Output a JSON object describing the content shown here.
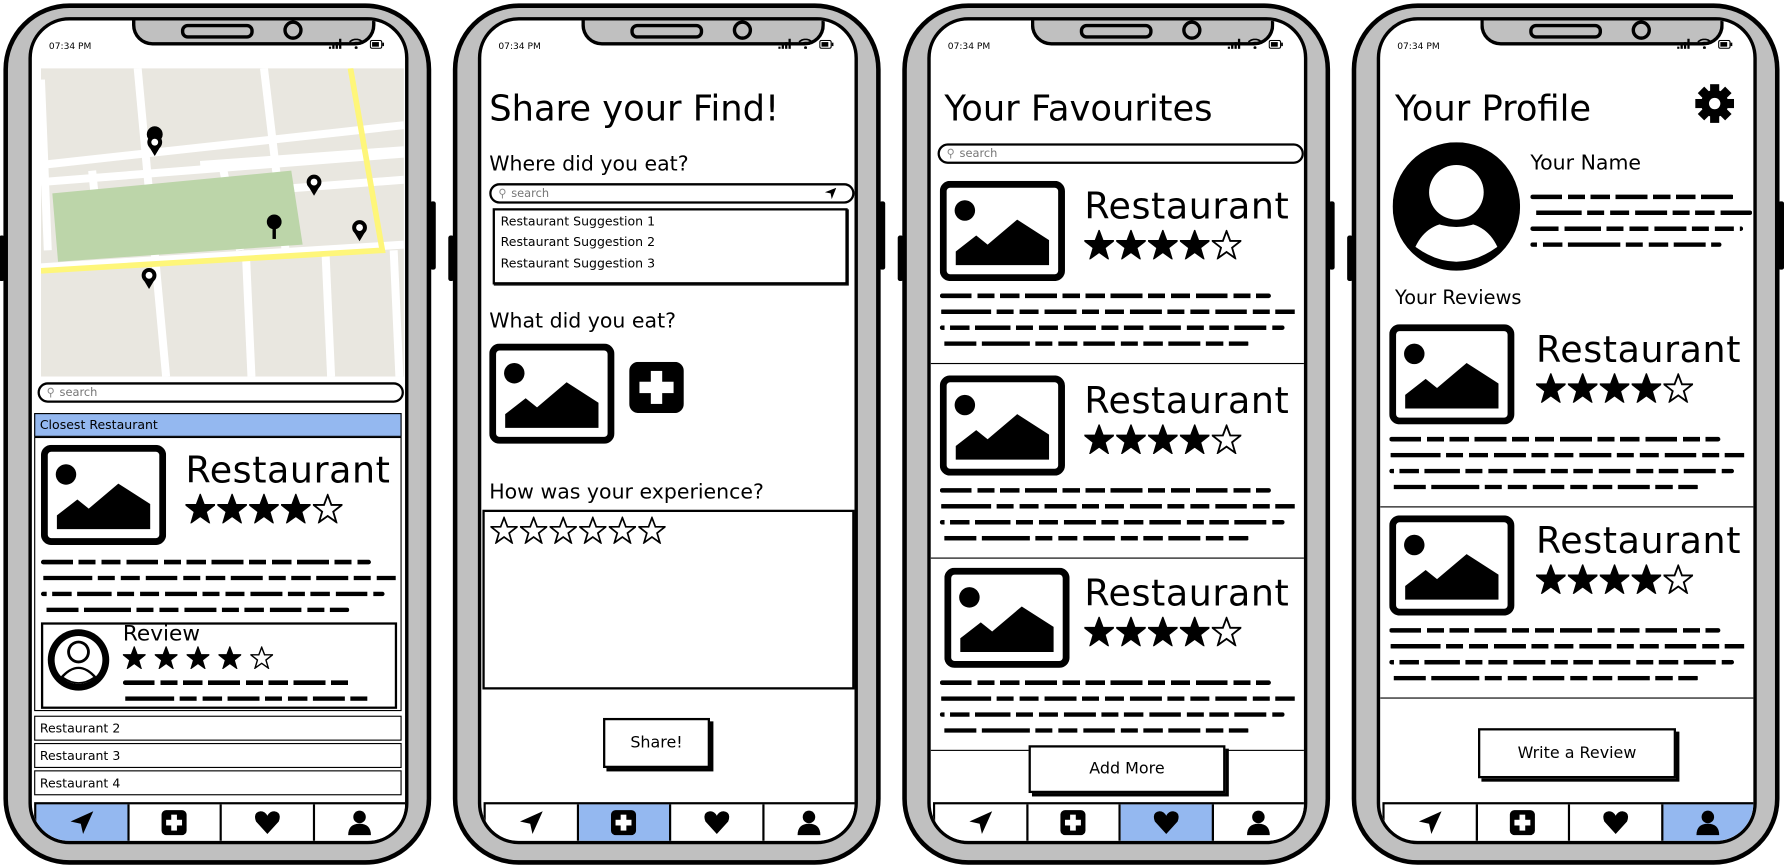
{
  "status_bar": {
    "time": "07:34 PM"
  },
  "colors": {
    "active_tab": "#94b8f0",
    "header_bar": "#94b8f0",
    "phone_frame": "#c0c0c0",
    "map_bg": "#e9e7e0",
    "park": "#bcd5a9",
    "main_road": "#fef67a"
  },
  "tabs": [
    {
      "name": "navigate",
      "icon": "navigation-arrow-icon"
    },
    {
      "name": "add",
      "icon": "plus-square-icon"
    },
    {
      "name": "favourites",
      "icon": "heart-icon"
    },
    {
      "name": "profile",
      "icon": "person-icon"
    }
  ],
  "map_screen": {
    "active_tab": 0,
    "search_placeholder": "search",
    "closest_header": "Closest Restaurant",
    "featured": {
      "name": "Restaurant",
      "rating": 4,
      "max_rating": 5
    },
    "review": {
      "label": "Review",
      "rating": 4,
      "max_rating": 5
    },
    "list": [
      "Restaurant 2",
      "Restaurant 3",
      "Restaurant 4"
    ]
  },
  "share_screen": {
    "active_tab": 1,
    "title": "Share your Find!",
    "where_label": "Where did you eat?",
    "search_placeholder": "search",
    "suggestions": [
      "Restaurant Suggestion 1",
      "Restaurant Suggestion 2",
      "Restaurant Suggestion 3"
    ],
    "what_label": "What did you eat?",
    "experience_label": "How was your experience?",
    "rating": 0,
    "max_rating": 6,
    "share_button": "Share!"
  },
  "favourites_screen": {
    "active_tab": 2,
    "title": "Your Favourites",
    "search_placeholder": "search",
    "items": [
      {
        "name": "Restaurant",
        "rating": 4,
        "max_rating": 5
      },
      {
        "name": "Restaurant",
        "rating": 4,
        "max_rating": 5
      },
      {
        "name": "Restaurant",
        "rating": 4,
        "max_rating": 5
      }
    ],
    "add_more_button": "Add More"
  },
  "profile_screen": {
    "active_tab": 3,
    "title": "Your Profile",
    "name_label": "Your Name",
    "reviews_label": "Your Reviews",
    "items": [
      {
        "name": "Restaurant",
        "rating": 4,
        "max_rating": 5
      },
      {
        "name": "Restaurant",
        "rating": 4,
        "max_rating": 5
      }
    ],
    "write_review_button": "Write a Review"
  }
}
